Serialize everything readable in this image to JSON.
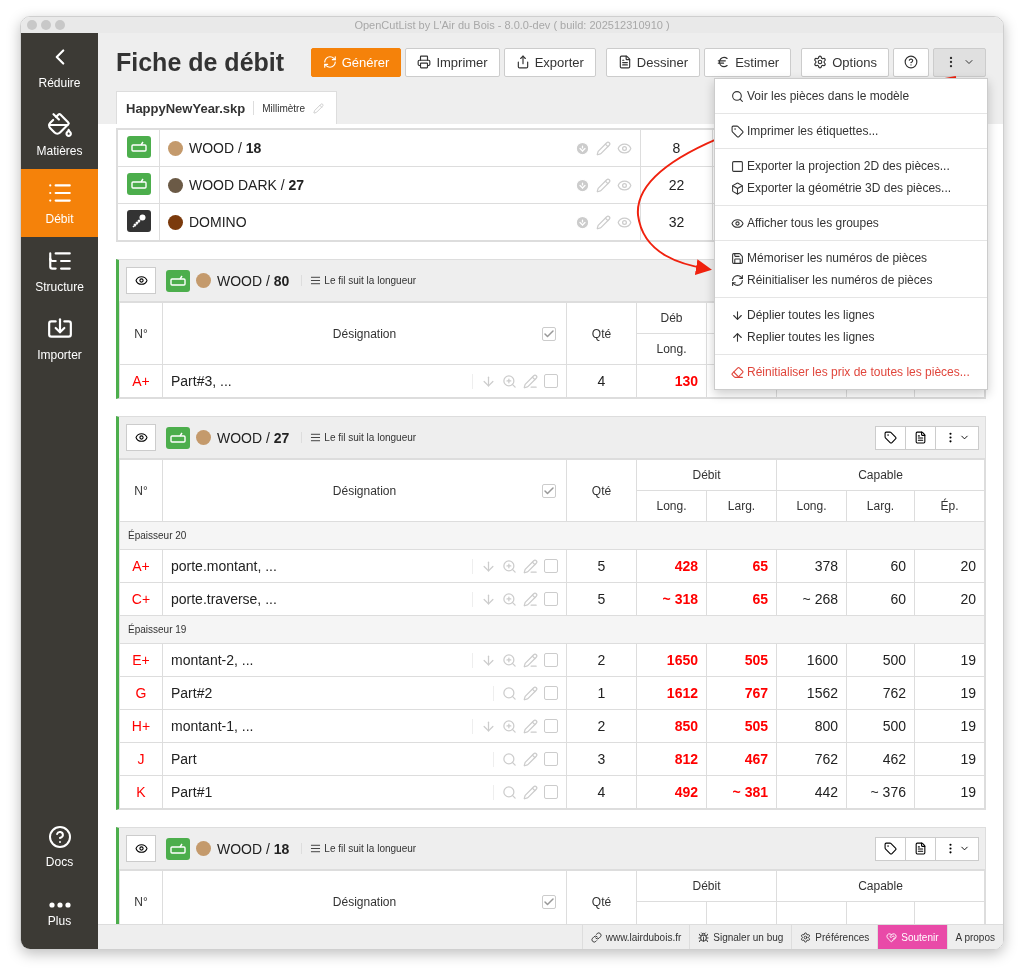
{
  "window": {
    "title": "OpenCutList by L'Air du Bois - 8.0.0-dev ( build: 202512310910 )"
  },
  "sidebar": {
    "items": [
      {
        "label": "Réduire",
        "selected": false
      },
      {
        "label": "Matières",
        "selected": false
      },
      {
        "label": "Débit",
        "selected": true
      },
      {
        "label": "Structure",
        "selected": false
      },
      {
        "label": "Importer",
        "selected": false
      }
    ],
    "bottom_items": [
      {
        "label": "Docs",
        "selected": false
      },
      {
        "label": "Plus",
        "selected": false
      }
    ]
  },
  "header": {
    "title": "Fiche de débit",
    "toolbar": [
      [
        {
          "label": "Générer",
          "kind": "primary",
          "pressed": false
        },
        {
          "label": "Imprimer",
          "kind": "default",
          "pressed": false
        },
        {
          "label": "Exporter",
          "kind": "default",
          "pressed": false
        }
      ],
      [
        {
          "label": "Dessiner",
          "kind": "default",
          "pressed": false
        },
        {
          "label": "Estimer",
          "kind": "default",
          "pressed": false
        }
      ],
      [
        {
          "label": "Options",
          "kind": "default",
          "pressed": false
        },
        {
          "kind": "default",
          "pressed": false
        },
        {
          "kind": "dropdown",
          "pressed": true
        }
      ]
    ]
  },
  "tab": {
    "file": "HappyNewYear.skp",
    "unit": "Millimètre"
  },
  "summary": {
    "rows": [
      {
        "kind": "sheet",
        "color": "#c49a6c",
        "label": "WOOD / **18**",
        "quantity": "8"
      },
      {
        "kind": "sheet",
        "color": "#6b5a46",
        "label": "WOOD DARK / **27**",
        "quantity": "22"
      },
      {
        "kind": "hardware",
        "color": "#7b3a0c",
        "label": "DOMINO",
        "quantity": "32"
      }
    ]
  },
  "groups": [
    {
      "color": "#c49a6c",
      "label": "WOOD / **80**",
      "grain": "Le fil suit la longueur",
      "tools": false,
      "select_all_checked": true,
      "columns": {
        "number": "N°",
        "designation": "Désignation",
        "quantity": "Qté",
        "debit": "Déb",
        "sub": [
          "Long."
        ]
      },
      "rows": [
        {
          "kind": "part",
          "number": "A+",
          "name": "Part#3, ...",
          "grouped": true,
          "checked": false,
          "quantity": "4",
          "values": [
            "130"
          ]
        }
      ]
    },
    {
      "color": "#c49a6c",
      "label": "WOOD / **27**",
      "grain": "Le fil suit la longueur",
      "tools": true,
      "select_all_checked": true,
      "columns": {
        "number": "N°",
        "designation": "Désignation",
        "quantity": "Qté",
        "debit": "Débit",
        "capable": "Capable",
        "sub": [
          "Long.",
          "Larg.",
          "Long.",
          "Larg.",
          "Ép."
        ]
      },
      "rows": [
        {
          "kind": "section",
          "label": "Épaisseur 20"
        },
        {
          "kind": "part",
          "number": "A+",
          "name": "porte.montant, ...",
          "grouped": true,
          "checked": false,
          "quantity": "5",
          "values": [
            "428",
            "65",
            "378",
            "60",
            "20"
          ]
        },
        {
          "kind": "part",
          "number": "C+",
          "name": "porte.traverse, ...",
          "grouped": true,
          "checked": false,
          "quantity": "5",
          "values": [
            "~ 318",
            "65",
            "~ 268",
            "60",
            "20"
          ]
        },
        {
          "kind": "section",
          "label": "Épaisseur 19"
        },
        {
          "kind": "part",
          "number": "E+",
          "name": "montant-2, ...",
          "grouped": true,
          "checked": false,
          "quantity": "2",
          "values": [
            "1650",
            "505",
            "1600",
            "500",
            "19"
          ]
        },
        {
          "kind": "part",
          "number": "G",
          "name": "Part#2",
          "grouped": false,
          "checked": false,
          "quantity": "1",
          "values": [
            "1612",
            "767",
            "1562",
            "762",
            "19"
          ]
        },
        {
          "kind": "part",
          "number": "H+",
          "name": "montant-1, ...",
          "grouped": true,
          "checked": false,
          "quantity": "2",
          "values": [
            "850",
            "505",
            "800",
            "500",
            "19"
          ]
        },
        {
          "kind": "part",
          "number": "J",
          "name": "Part",
          "grouped": false,
          "checked": false,
          "quantity": "3",
          "values": [
            "812",
            "467",
            "762",
            "462",
            "19"
          ]
        },
        {
          "kind": "part",
          "number": "K",
          "name": "Part#1",
          "grouped": false,
          "checked": false,
          "quantity": "4",
          "values": [
            "492",
            "~ 381",
            "442",
            "~ 376",
            "19"
          ]
        }
      ]
    },
    {
      "color": "#c49a6c",
      "label": "WOOD / **18**",
      "grain": "Le fil suit la longueur",
      "tools": true,
      "select_all_checked": true,
      "columns": {
        "number": "N°",
        "designation": "Désignation",
        "quantity": "Qté",
        "debit": "Débit",
        "capable": "Capable"
      }
    }
  ],
  "menu": {
    "groups": [
      [
        {
          "label": "Voir les pièces dans le modèle",
          "danger": false
        }
      ],
      [
        {
          "label": "Imprimer les étiquettes...",
          "danger": false
        }
      ],
      [
        {
          "label": "Exporter la projection 2D des pièces...",
          "danger": false
        },
        {
          "label": "Exporter la géométrie 3D des pièces...",
          "danger": false
        }
      ],
      [
        {
          "label": "Afficher tous les groupes",
          "danger": false
        }
      ],
      [
        {
          "label": "Mémoriser les numéros de pièces",
          "danger": false
        },
        {
          "label": "Réinitialiser les numéros de pièces",
          "danger": false
        }
      ],
      [
        {
          "label": "Déplier toutes les lignes",
          "danger": false
        },
        {
          "label": "Replier toutes les lignes",
          "danger": false
        }
      ],
      [
        {
          "label": "Réinitialiser les prix de toutes les pièces...",
          "danger": true
        }
      ]
    ]
  },
  "status_bar": [
    {
      "label": "www.lairdubois.fr",
      "kind": "default"
    },
    {
      "label": "Signaler un bug",
      "kind": "default"
    },
    {
      "label": "Préférences",
      "kind": "default"
    },
    {
      "label": "Soutenir",
      "kind": "accent"
    },
    {
      "label": "A propos",
      "kind": "default"
    }
  ]
}
